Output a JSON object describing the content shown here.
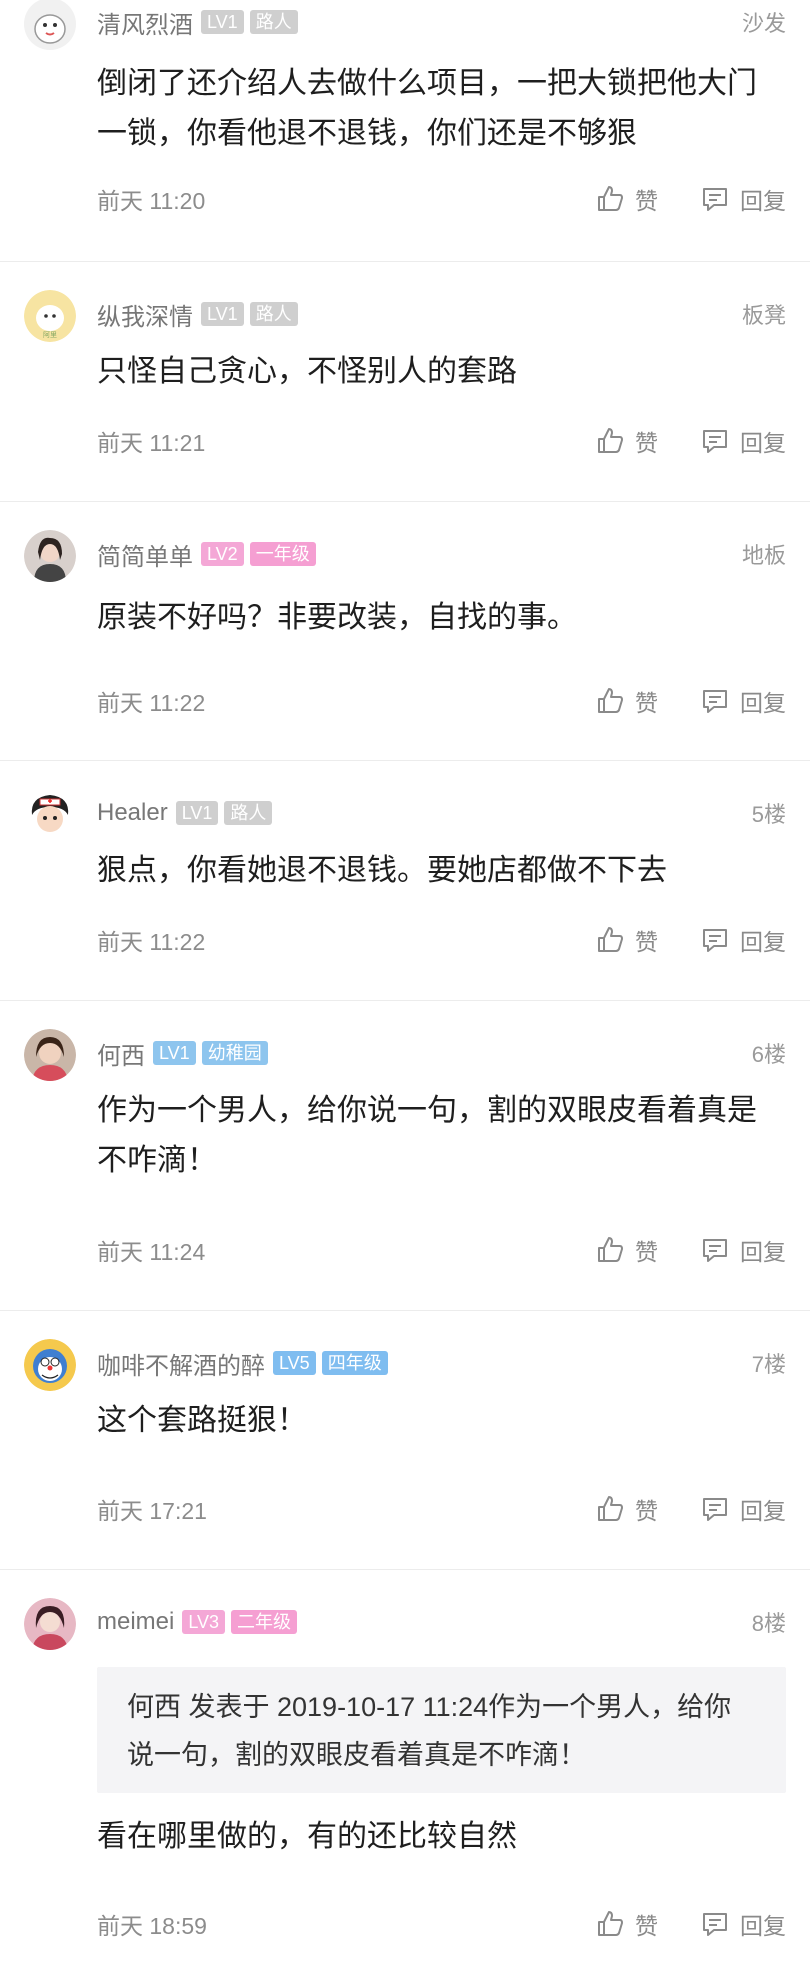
{
  "comments": [
    {
      "name": "清风烈酒",
      "level": "LV1",
      "rank": "路人",
      "floor": "沙发",
      "text": "倒闭了还介绍人去做什么项目，一把大锁把他大门一锁，你看他退不退钱，你们还是不够狠",
      "time": "前天 11:20",
      "like": "赞",
      "reply": "回复",
      "level_color": "#cfcfcf",
      "rank_color": "#cfcfcf"
    },
    {
      "name": "纵我深情",
      "level": "LV1",
      "rank": "路人",
      "floor": "板凳",
      "text": "只怪自己贪心，不怪别人的套路",
      "time": "前天 11:21",
      "like": "赞",
      "reply": "回复",
      "level_color": "#cfcfcf",
      "rank_color": "#cfcfcf"
    },
    {
      "name": "简简单单",
      "level": "LV2",
      "rank": "一年级",
      "floor": "地板",
      "text": "原装不好吗？非要改装，自找的事。",
      "time": "前天 11:22",
      "like": "赞",
      "reply": "回复",
      "level_color": "#f4a7d6",
      "rank_color": "#f59fd2"
    },
    {
      "name": "Healer",
      "level": "LV1",
      "rank": "路人",
      "floor": "5楼",
      "text": "狠点，你看她退不退钱。要她店都做不下去",
      "time": "前天 11:22",
      "like": "赞",
      "reply": "回复",
      "level_color": "#cfcfcf",
      "rank_color": "#cfcfcf"
    },
    {
      "name": "何西",
      "level": "LV1",
      "rank": "幼稚园",
      "floor": "6楼",
      "text": "作为一个男人，给你说一句，割的双眼皮看着真是不咋滴！",
      "time": "前天 11:24",
      "like": "赞",
      "reply": "回复",
      "level_color": "#8ec5ee",
      "rank_color": "#8ec5ee"
    },
    {
      "name": "咖啡不解酒的醉",
      "level": "LV5",
      "rank": "四年级",
      "floor": "7楼",
      "text": "这个套路挺狠！",
      "time": "前天 17:21",
      "like": "赞",
      "reply": "回复",
      "level_color": "#7fbdf0",
      "rank_color": "#7fbdf0"
    },
    {
      "name": "meimei",
      "level": "LV3",
      "rank": "二年级",
      "floor": "8楼",
      "quote": "何西 发表于 2019-10-17 11:24作为一个男人，给你说一句，割的双眼皮看着真是不咋滴！",
      "text": "看在哪里做的，有的还比较自然",
      "time": "前天 18:59",
      "like": "赞",
      "reply": "回复",
      "level_color": "#f4a7d6",
      "rank_color": "#f59fd2"
    }
  ],
  "icons": {
    "like": "thumbs-up-icon",
    "reply": "comment-icon"
  }
}
